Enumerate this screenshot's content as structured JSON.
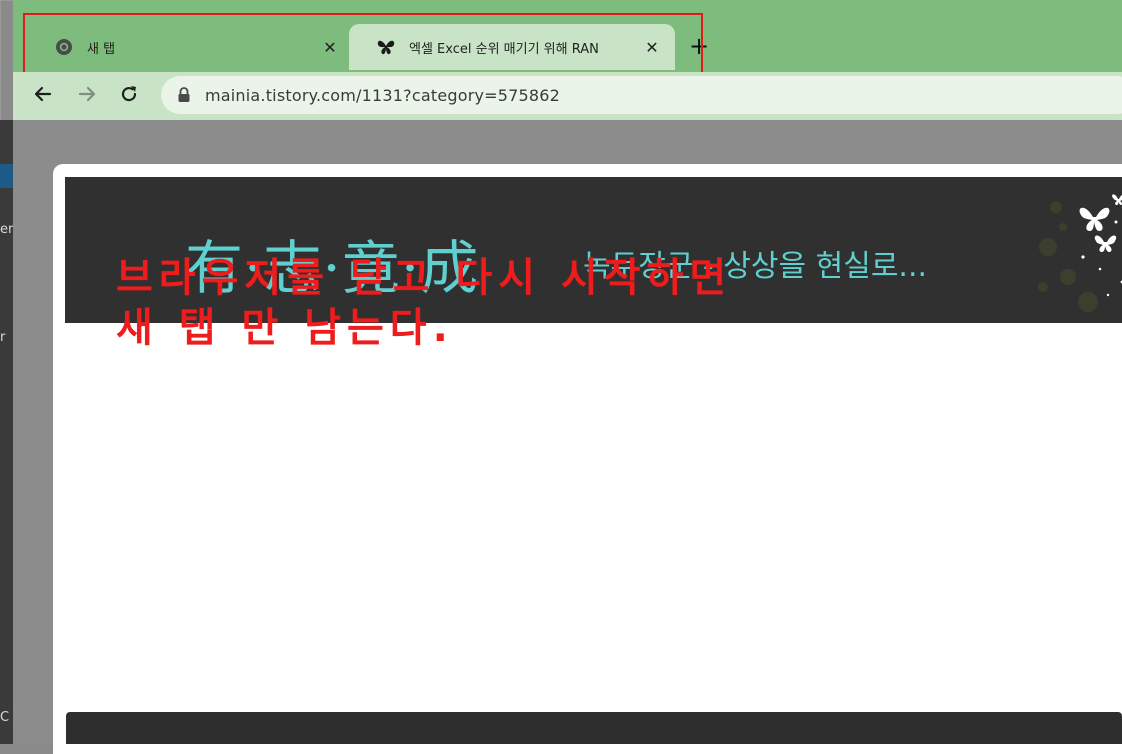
{
  "browser": {
    "tabs": [
      {
        "title": "새 탭",
        "favicon": "chrome-icon",
        "active": false
      },
      {
        "title": "엑셀 Excel 순위 매기기 위해 RAN",
        "favicon": "butterfly-icon",
        "active": true
      }
    ],
    "close_glyph": "✕",
    "new_tab_glyph": "+",
    "url": "mainia.tistory.com/1131?category=575862",
    "nav_icons": [
      "back-arrow-icon",
      "forward-arrow-icon",
      "reload-icon",
      "lock-icon"
    ]
  },
  "page": {
    "blog_logo": "有·志·竟·成",
    "blog_tagline": "녹두장군 - 상상을 현실로...",
    "message_line1": "브라우저를 닫고 다시 시작하면",
    "message_line2": "새 탭 만 남는다."
  },
  "desktop": {
    "left_glyphs": [
      "er",
      "r",
      "C"
    ]
  },
  "colors": {
    "tab_strip": "#7ebc7d",
    "active_tab": "#c9e3c6",
    "highlight_box": "#e01b1b",
    "banner_bg": "#303030",
    "banner_text": "#5fcfcf",
    "message_red": "#ee1c1c"
  }
}
